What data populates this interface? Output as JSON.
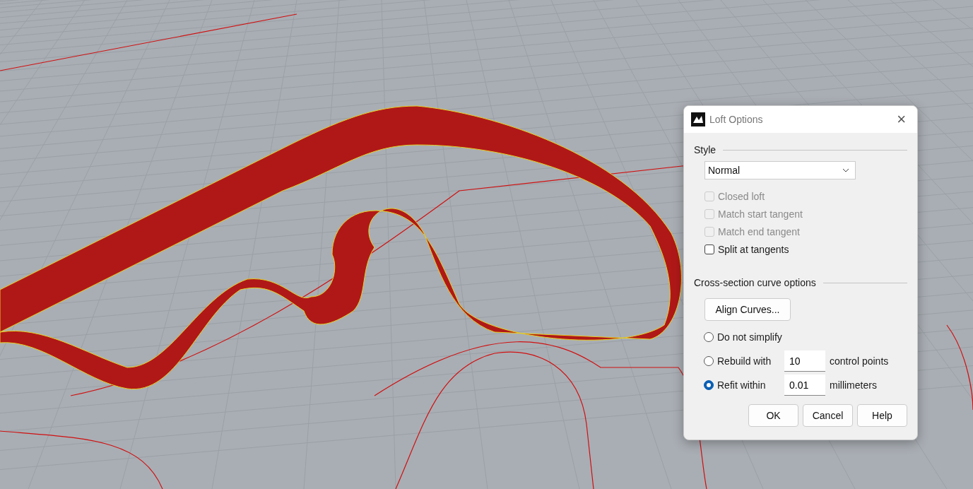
{
  "dialog": {
    "title": "Loft Options",
    "close": "×",
    "style_section": {
      "label": "Style",
      "dropdown": {
        "value": "Normal"
      },
      "options": [
        {
          "label": "Closed loft",
          "checked": false,
          "disabled": true
        },
        {
          "label": "Match start tangent",
          "checked": false,
          "disabled": true
        },
        {
          "label": "Match end tangent",
          "checked": false,
          "disabled": true
        },
        {
          "label": "Split at tangents",
          "checked": false,
          "disabled": false
        }
      ]
    },
    "cross_section": {
      "label": "Cross-section curve options",
      "align_button": "Align Curves...",
      "choices": [
        {
          "label": "Do not simplify",
          "selected": false
        },
        {
          "label": "Rebuild with",
          "selected": false,
          "value": "10",
          "unit": "control points"
        },
        {
          "label": "Refit within",
          "selected": true,
          "value": "0.01",
          "unit": "millimeters"
        }
      ]
    },
    "buttons": [
      "OK",
      "Cancel",
      "Help"
    ]
  }
}
